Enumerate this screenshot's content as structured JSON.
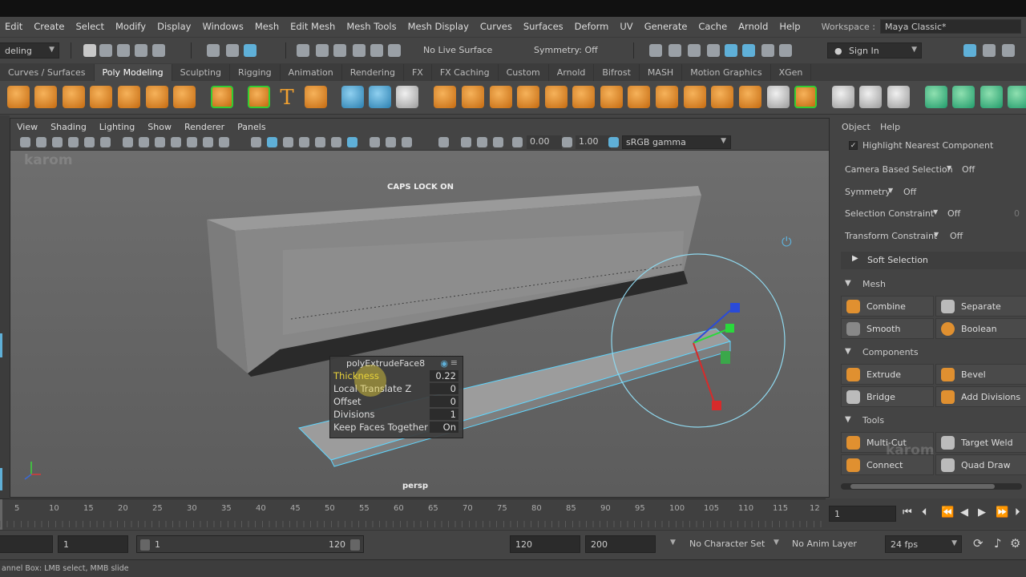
{
  "menus": [
    "Edit",
    "Create",
    "Select",
    "Modify",
    "Display",
    "Windows",
    "Mesh",
    "Edit Mesh",
    "Mesh Tools",
    "Mesh Display",
    "Curves",
    "Surfaces",
    "Deform",
    "UV",
    "Generate",
    "Cache",
    "Arnold",
    "Help"
  ],
  "workspace": {
    "label": "Workspace :",
    "value": "Maya Classic*"
  },
  "status": {
    "mode": "deling",
    "live_surface": "No Live Surface",
    "symmetry": "Symmetry: Off",
    "sign_in": "Sign In"
  },
  "shelf_tabs": [
    "Curves / Surfaces",
    "Poly Modeling",
    "Sculpting",
    "Rigging",
    "Animation",
    "Rendering",
    "FX",
    "FX Caching",
    "Custom",
    "Arnold",
    "Bifrost",
    "MASH",
    "Motion Graphics",
    "XGen"
  ],
  "shelf_active": "Poly Modeling",
  "panel_menu": [
    "View",
    "Shading",
    "Lighting",
    "Show",
    "Renderer",
    "Panels"
  ],
  "panel_tools": {
    "exposure": "0.00",
    "gamma": "1.00",
    "colorspace": "sRGB gamma"
  },
  "viewport": {
    "watermark": "karom",
    "caps": "CAPS LOCK ON",
    "camera": "persp"
  },
  "extrude": {
    "title": "polyExtrudeFace8",
    "rows": [
      {
        "label": "Thickness",
        "value": "0.22"
      },
      {
        "label": "Local Translate Z",
        "value": "0"
      },
      {
        "label": "Offset",
        "value": "0"
      },
      {
        "label": "Divisions",
        "value": "1"
      },
      {
        "label": "Keep Faces Together",
        "value": "On"
      }
    ]
  },
  "right_panel": {
    "menu": [
      "Object",
      "Help"
    ],
    "highlight": "Highlight Nearest Component",
    "camera_based": {
      "label": "Camera Based Selection",
      "value": "Off"
    },
    "symmetry": {
      "label": "Symmetry",
      "value": "Off"
    },
    "sel_constraint": {
      "label": "Selection Constraint",
      "value": "Off",
      "extra": "0"
    },
    "xform_constraint": {
      "label": "Transform Constraint",
      "value": "Off"
    },
    "soft_selection": "Soft Selection",
    "mesh": {
      "title": "Mesh",
      "buttons": [
        "Combine",
        "Separate",
        "Smooth",
        "Boolean"
      ]
    },
    "components": {
      "title": "Components",
      "buttons": [
        "Extrude",
        "Bevel",
        "Bridge",
        "Add Divisions"
      ]
    },
    "tools": {
      "title": "Tools",
      "buttons": [
        "Multi-Cut",
        "Target Weld",
        "Connect",
        "Quad Draw"
      ]
    },
    "watermark": "karom"
  },
  "timeline": {
    "ticks": [
      "5",
      "10",
      "15",
      "20",
      "25",
      "30",
      "35",
      "40",
      "45",
      "50",
      "55",
      "60",
      "65",
      "70",
      "75",
      "80",
      "85",
      "90",
      "95",
      "100",
      "105",
      "110",
      "115",
      "12"
    ],
    "current": "1"
  },
  "range": {
    "start": "1",
    "inner_start": "1",
    "inner_end": "120",
    "end": "120",
    "max": "200",
    "char_set": "No Character Set",
    "anim_layer": "No Anim Layer",
    "fps": "24 fps"
  },
  "helpline": "annel Box: LMB select, MMB slide",
  "colors": {
    "accent": "#5fb0d8",
    "selection": "#5fd6ff",
    "highlight": "#e8d23a"
  }
}
